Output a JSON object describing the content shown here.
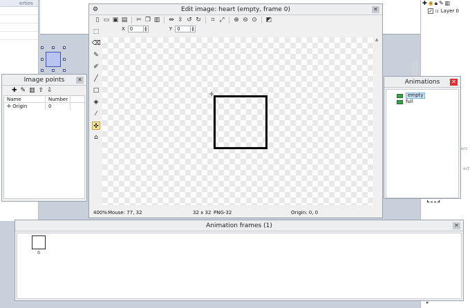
{
  "background": {
    "left_panel_header": "erties",
    "right_panel_header_fragment": "ers",
    "right_panel_fragment": "ect",
    "layers": {
      "toolbar": [
        "+",
        "eye",
        "lock",
        "pencil",
        "trash"
      ],
      "items": [
        {
          "label": "Layer 0",
          "checked": true
        }
      ]
    }
  },
  "edit_image": {
    "title": "Edit image: heart (empty, frame 0)",
    "toolbar": [
      "new-icon",
      "open-icon",
      "save-icon",
      "save-as-icon",
      "cut-icon",
      "copy-icon",
      "paste-icon",
      "flip-horizontal-icon",
      "flip-vertical-icon",
      "rotate-left-icon",
      "rotate-right-icon",
      "crop-icon",
      "resize-icon",
      "zoom-in-icon",
      "zoom-out-icon",
      "zoom-fit-icon",
      "image-settings-icon"
    ],
    "x_label": "X",
    "x_value": "0",
    "y_label": "Y",
    "y_value": "0",
    "tools": [
      "select-icon",
      "eraser-icon",
      "pencil-icon",
      "brush-icon",
      "line-icon",
      "rectangle-icon",
      "fill-icon",
      "color-picker-icon",
      "origin-icon",
      "polygon-icon"
    ],
    "active_tool": "origin-icon",
    "status": {
      "zoom": "400%",
      "mouse": "Mouse: 77, 32",
      "size": "32 x 32",
      "format": "PNG-32",
      "origin": "Origin: 0, 0"
    }
  },
  "image_points": {
    "title": "Image points",
    "toolbar": [
      "add-icon",
      "edit-icon",
      "delete-icon",
      "move-up-icon",
      "move-down-icon"
    ],
    "columns": [
      "Name",
      "Number"
    ],
    "rows": [
      {
        "name": "Origin",
        "number": "0"
      }
    ]
  },
  "animations": {
    "title": "Animations",
    "items": [
      {
        "label": "empty",
        "selected": true
      },
      {
        "label": "full",
        "selected": false
      }
    ]
  },
  "animation_frames": {
    "title": "Animation frames (1)",
    "frames": [
      {
        "label": "0"
      }
    ]
  },
  "colors": {
    "selected_tool_bg": "#f7e59a",
    "animations_close": "#d93232",
    "selection_highlight": "#cbe4f8"
  }
}
